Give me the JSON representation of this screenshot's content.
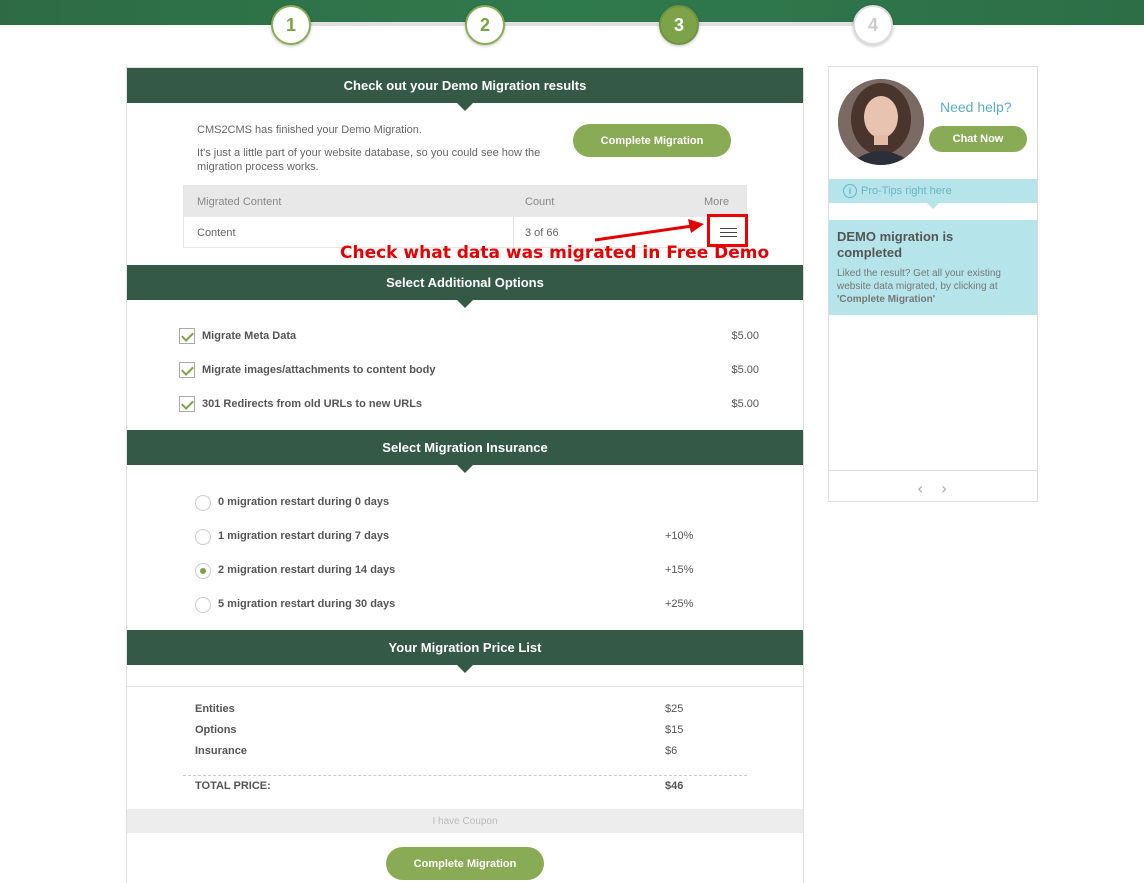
{
  "steps": [
    "1",
    "2",
    "3",
    "4"
  ],
  "results": {
    "title": "Check out your Demo Migration results",
    "intro_line1": "CMS2CMS has finished your Demo Migration.",
    "intro_line2": "It's just a little part of your website database, so you could see how the migration process works.",
    "complete_button": "Complete Migration",
    "table": {
      "headers": [
        "Migrated Content",
        "Count",
        "More"
      ],
      "rows": [
        {
          "name": "Content",
          "count": "3 of 66"
        }
      ]
    }
  },
  "annotation": "Check what data was migrated in Free Demo",
  "options": {
    "title": "Select Additional Options",
    "items": [
      {
        "label": "Migrate Meta Data",
        "price": "$5.00"
      },
      {
        "label": "Migrate images/attachments to content body",
        "price": "$5.00"
      },
      {
        "label": "301 Redirects from old URLs to new URLs",
        "price": "$5.00"
      }
    ]
  },
  "insurance": {
    "title": "Select Migration Insurance",
    "items": [
      {
        "label": "0 migration restart during 0 days",
        "pct": ""
      },
      {
        "label": "1 migration restart during 7 days",
        "pct": "+10%"
      },
      {
        "label": "2 migration restart during 14 days",
        "pct": "+15%",
        "selected": true
      },
      {
        "label": "5 migration restart during 30 days",
        "pct": "+25%"
      }
    ]
  },
  "price_list": {
    "title": "Your Migration Price List",
    "rows": [
      {
        "label": "Entities",
        "value": "$25"
      },
      {
        "label": "Options",
        "value": "$15"
      },
      {
        "label": "Insurance",
        "value": "$6"
      }
    ],
    "total_label": "TOTAL PRICE:",
    "total_value": "$46",
    "coupon": "I have Coupon",
    "complete_button": "Complete Migration"
  },
  "sidebar": {
    "need_help": "Need help?",
    "chat_button": "Chat Now",
    "protips": "Pro-Tips right here",
    "tip_title": "DEMO migration is completed",
    "tip_text_prefix": "Liked the result? Get all your existing website data migrated, by clicking at ",
    "tip_text_bold": "'Complete Migration'"
  },
  "colors": {
    "accent_green": "#8aab55",
    "header_dark": "#345a47",
    "tip_blue": "#b5e5ea",
    "annotation_red": "#e30000"
  }
}
